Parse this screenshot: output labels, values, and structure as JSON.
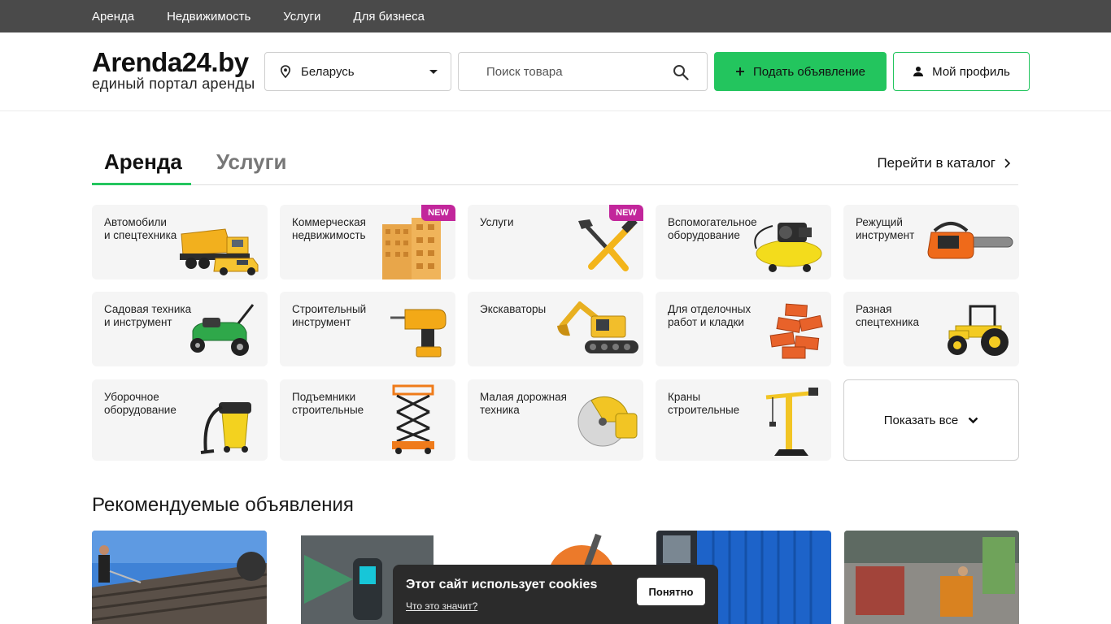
{
  "topnav": [
    "Аренда",
    "Недвижимость",
    "Услуги",
    "Для бизнеса"
  ],
  "logo": {
    "title": "Arenda24.by",
    "subtitle": "единый портал аренды"
  },
  "region": {
    "value": "Беларусь"
  },
  "search": {
    "placeholder": "Поиск товара"
  },
  "buttons": {
    "post_ad": "Подать объявление",
    "profile": "Мой профиль"
  },
  "tabs": {
    "active": "Аренда",
    "inactive": "Услуги",
    "catalog_link": "Перейти в каталог"
  },
  "categories": [
    {
      "label": "Автомобили\nи спецтехника",
      "badge": ""
    },
    {
      "label": "Коммерческая\nнедвижимость",
      "badge": "NEW"
    },
    {
      "label": "Услуги",
      "badge": "NEW"
    },
    {
      "label": "Вспомогательное\nоборудование",
      "badge": ""
    },
    {
      "label": "Режущий\nинструмент",
      "badge": ""
    },
    {
      "label": "Садовая техника\nи инструмент",
      "badge": ""
    },
    {
      "label": "Строительный\nинструмент",
      "badge": ""
    },
    {
      "label": "Экскаваторы",
      "badge": ""
    },
    {
      "label": "Для отделочных\nработ и кладки",
      "badge": ""
    },
    {
      "label": "Разная\nспецтехника",
      "badge": ""
    },
    {
      "label": "Уборочное\nоборудование",
      "badge": ""
    },
    {
      "label": "Подъемники\nстроительные",
      "badge": ""
    },
    {
      "label": "Малая дорожная\nтехника",
      "badge": ""
    },
    {
      "label": "Краны\nстроительные",
      "badge": ""
    }
  ],
  "show_all": "Показать все",
  "recommended": {
    "title": "Рекомендуемые объявления"
  },
  "cookies": {
    "title": "Этот сайт использует cookies",
    "link": "Что это значит?",
    "button": "Понятно"
  },
  "colors": {
    "accent": "#23c55e",
    "topbar": "#4a4a4a",
    "badge": "#c2269b",
    "cookie_bg": "#2b2b2b"
  }
}
